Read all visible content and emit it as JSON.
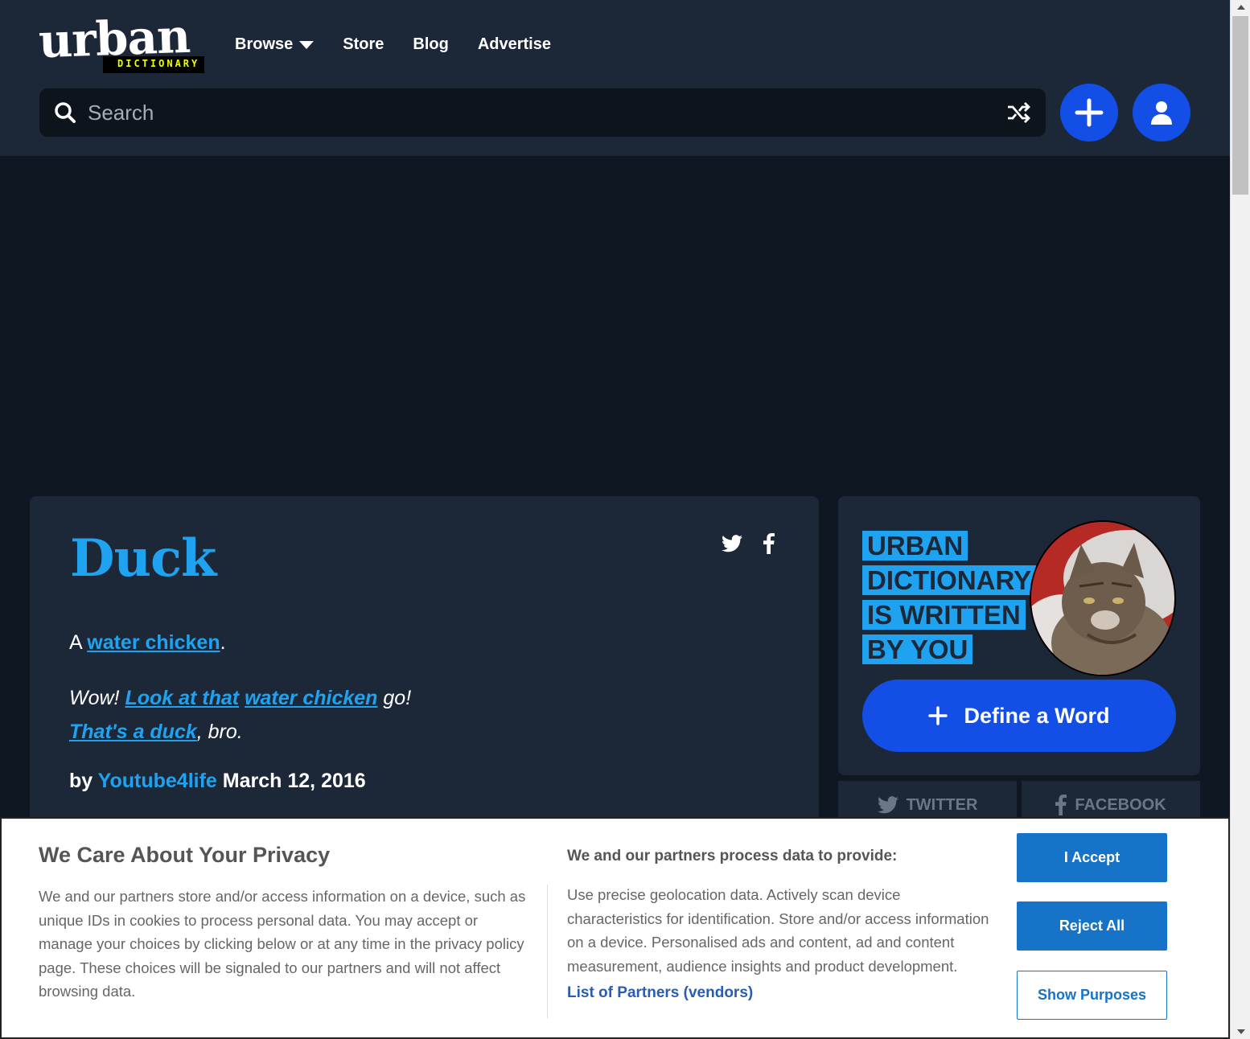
{
  "header": {
    "logo_word": "urban",
    "logo_tag": "DICTIONARY",
    "nav": [
      "Browse",
      "Store",
      "Blog",
      "Advertise"
    ],
    "search_placeholder": "Search"
  },
  "definition": {
    "word": "Duck",
    "meaning_prefix": "A ",
    "meaning_link": "water chicken",
    "meaning_suffix": ".",
    "example_line1_pre": "Wow! ",
    "example_link1": "Look at that",
    "example_space": " ",
    "example_link2": "water chicken",
    "example_line1_post": " go!",
    "example_link3": "That's a duck",
    "example_line2_post": ", bro.",
    "by_label": "by ",
    "author": "Youtube4life",
    "date": " March 12, 2016"
  },
  "sidebar": {
    "written_by_lines": [
      "URBAN",
      "DICTIONARY",
      "IS WRITTEN",
      "BY YOU"
    ],
    "define_button": "Define a Word",
    "twitter_label": "TWITTER",
    "facebook_label": "FACEBOOK"
  },
  "privacy": {
    "title": "We Care About Your Privacy",
    "text": "We and our partners store and/or access information on a device, such as unique IDs in cookies to process personal data. You may accept or manage your choices by clicking below or at any time in the privacy policy page. These choices will be signaled to our partners and will not affect browsing data.",
    "process_title": "We and our partners process data to provide:",
    "process_text": "Use precise geolocation data. Actively scan device characteristics for identification. Store and/or access information on a device. Personalised ads and content, ad and content measurement, audience insights and product development.",
    "partners_link": "List of Partners (vendors)",
    "accept": "I Accept",
    "reject": "Reject All",
    "show_purposes": "Show Purposes"
  },
  "colors": {
    "header_bg": "#1c2837",
    "page_bg": "#0f1723",
    "accent_blue": "#1fa3f1",
    "button_blue": "#134fe6",
    "consent_blue": "#1673c7"
  }
}
